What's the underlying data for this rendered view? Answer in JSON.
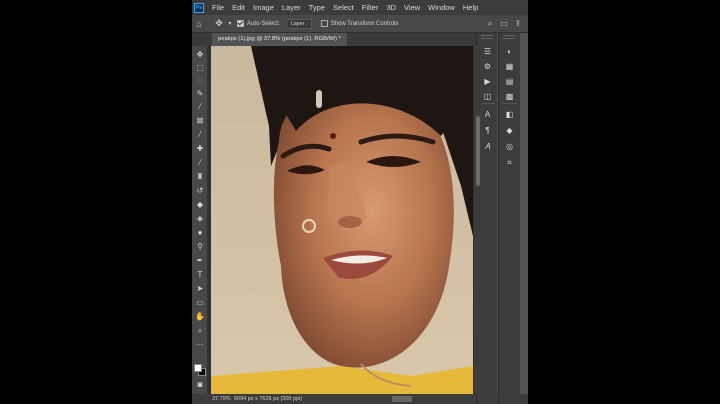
{
  "app": {
    "logo_text": "Ps",
    "menu": [
      "File",
      "Edit",
      "Image",
      "Layer",
      "Type",
      "Select",
      "Filter",
      "3D",
      "View",
      "Window",
      "Help"
    ]
  },
  "options_bar": {
    "auto_select_label": "Auto-Select:",
    "auto_select_checked": true,
    "auto_select_target": "Layer",
    "transform_label": "Show Transform Controls",
    "transform_checked": false
  },
  "document": {
    "tab_title": "peakpx (1).jpg @ 37.8% (peakpx (1), RGB/8#) *"
  },
  "status": {
    "zoom": "37.79%",
    "doc_info": "6094 px x 7626 px (300 ppi)"
  },
  "tools": [
    "move-tool",
    "marquee-tool",
    "lasso-tool",
    "quick-select-tool",
    "crop-tool",
    "frame-tool",
    "eyedropper-tool",
    "healing-brush-tool",
    "brush-tool",
    "clone-stamp-tool",
    "history-brush-tool",
    "eraser-tool",
    "paint-bucket-tool",
    "blur-tool",
    "dodge-tool",
    "pen-tool",
    "type-tool",
    "path-select-tool",
    "rectangle-tool",
    "hand-tool",
    "zoom-tool",
    "more-tools",
    "color-swatches",
    "quick-mask",
    "screen-mode"
  ],
  "colors": {
    "foreground": "#ffffff",
    "background": "#000000"
  }
}
